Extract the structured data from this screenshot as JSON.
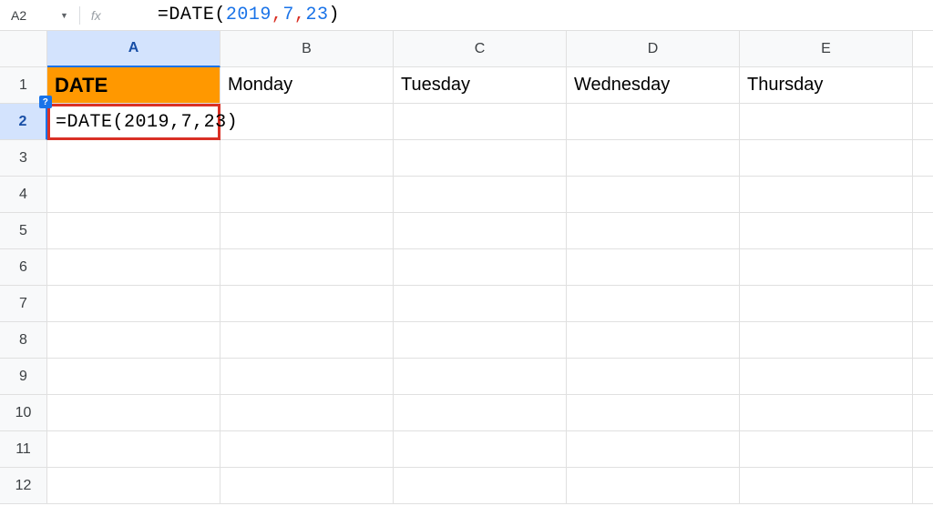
{
  "formula_bar": {
    "name_box": "A2",
    "fx_label": "fx",
    "formula": {
      "full": "=DATE(2019,7,23)",
      "eq": "=",
      "func": "DATE",
      "open": "(",
      "arg1": "2019",
      "c1": ",",
      "arg2": "7",
      "c2": ",",
      "arg3": "23",
      "close": ")"
    }
  },
  "columns": [
    "A",
    "B",
    "C",
    "D",
    "E"
  ],
  "selected_column": "A",
  "selected_row": 2,
  "row_count": 12,
  "cells": {
    "A1": "DATE",
    "B1": "Monday",
    "C1": "Tuesday",
    "D1": "Wednesday",
    "E1": "Thursday",
    "A2_editing": {
      "helper": "?",
      "eq": "=",
      "func": "DATE",
      "open": "(",
      "arg1": "2019",
      "c1": ",",
      "arg2": "7",
      "c2": ",",
      "arg3": "23",
      "close": ")"
    }
  },
  "colors": {
    "header_bg": "#ff9800",
    "selection": "#d3e3fd",
    "edit_border": "#d93025",
    "number": "#1a73e8"
  }
}
